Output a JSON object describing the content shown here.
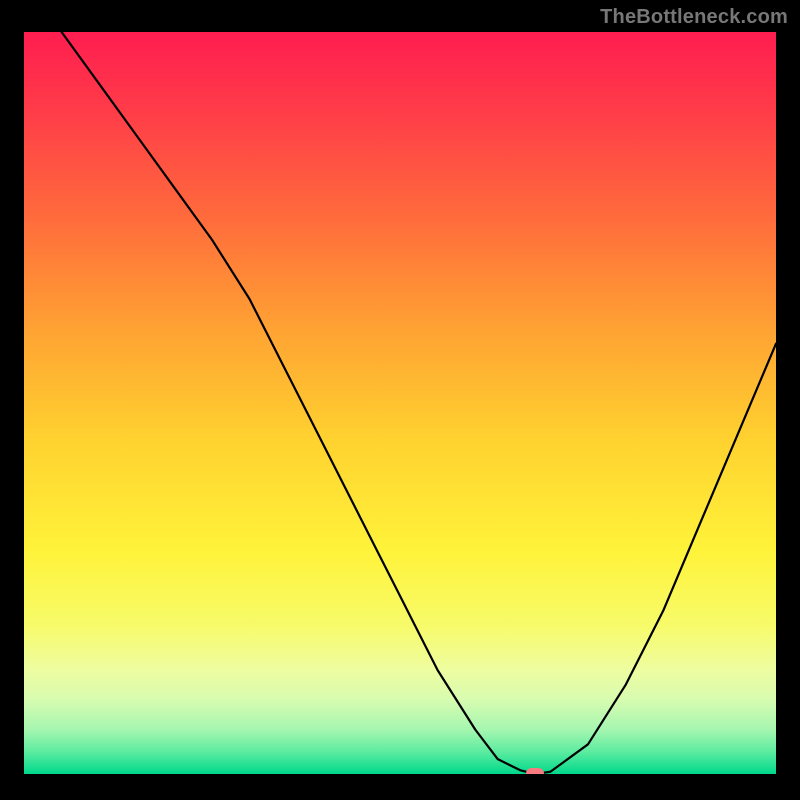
{
  "watermark": "TheBottleneck.com",
  "chart_data": {
    "type": "line",
    "title": "",
    "xlabel": "",
    "ylabel": "",
    "xlim": [
      0,
      100
    ],
    "ylim": [
      0,
      100
    ],
    "x": [
      5,
      10,
      15,
      20,
      25,
      30,
      35,
      40,
      45,
      50,
      55,
      60,
      63,
      66,
      68,
      70,
      75,
      80,
      85,
      90,
      95,
      100
    ],
    "values": [
      100,
      93,
      86,
      79,
      72,
      64,
      54,
      44,
      34,
      24,
      14,
      6,
      2,
      0.5,
      0,
      0.3,
      4,
      12,
      22,
      34,
      46,
      58
    ],
    "marker": {
      "x": 68,
      "y": 0,
      "color": "#f77b7f"
    },
    "gradient_stops": [
      {
        "offset": 0.0,
        "color": "#ff1d50"
      },
      {
        "offset": 0.1,
        "color": "#ff3a49"
      },
      {
        "offset": 0.25,
        "color": "#ff6b3c"
      },
      {
        "offset": 0.4,
        "color": "#ffa233"
      },
      {
        "offset": 0.55,
        "color": "#ffd22f"
      },
      {
        "offset": 0.7,
        "color": "#fff33a"
      },
      {
        "offset": 0.8,
        "color": "#f7fb6a"
      },
      {
        "offset": 0.86,
        "color": "#eefda0"
      },
      {
        "offset": 0.9,
        "color": "#d7fcb0"
      },
      {
        "offset": 0.94,
        "color": "#a6f6b0"
      },
      {
        "offset": 0.97,
        "color": "#5ceca0"
      },
      {
        "offset": 1.0,
        "color": "#00d88b"
      }
    ],
    "curve_color": "#000000",
    "curve_width": 2.2,
    "background": "#000000"
  }
}
